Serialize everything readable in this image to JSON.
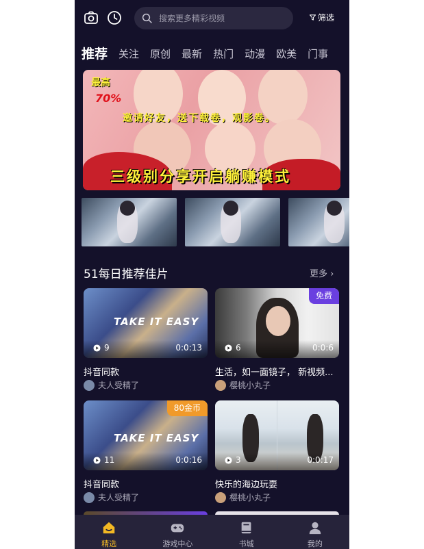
{
  "header": {
    "search_placeholder": "搜索更多精彩视频",
    "filter_label": "筛选"
  },
  "tabs": [
    {
      "label": "推荐"
    },
    {
      "label": "关注"
    },
    {
      "label": "原创"
    },
    {
      "label": "最新"
    },
    {
      "label": "热门"
    },
    {
      "label": "动漫"
    },
    {
      "label": "欧美"
    },
    {
      "label": "门事"
    }
  ],
  "banner": {
    "line_top": "最高",
    "line_pct": "70%",
    "line_mid": "邀请好友，送下载卷，观影卷。",
    "line_bottom": "三级别分享开启躺赚模式"
  },
  "section": {
    "title": "51每日推荐佳片",
    "more_label": "更多"
  },
  "videos": [
    {
      "title": "抖音同款",
      "author": "夫人受精了",
      "views": "9",
      "duration": "0:0:13",
      "badge": ""
    },
    {
      "title": "生活，如一面镜子， 新视频...",
      "author": "樱桃小丸子",
      "views": "6",
      "duration": "0:0:6",
      "badge": "免费"
    },
    {
      "title": "抖音同款",
      "author": "夫人受精了",
      "views": "11",
      "duration": "0:0:16",
      "badge": "80金币"
    },
    {
      "title": "快乐的海边玩耍",
      "author": "樱桃小丸子",
      "views": "3",
      "duration": "0:0:17",
      "badge": ""
    }
  ],
  "nav": [
    {
      "label": "精选",
      "icon": "home-icon"
    },
    {
      "label": "游戏中心",
      "icon": "gamepad-icon"
    },
    {
      "label": "书城",
      "icon": "book-icon"
    },
    {
      "label": "我的",
      "icon": "user-icon"
    }
  ],
  "colors": {
    "background": "#14112a",
    "accent": "#f2b824",
    "free_badge": "#6a3fe0",
    "coin_badge": "#f09a2a"
  }
}
